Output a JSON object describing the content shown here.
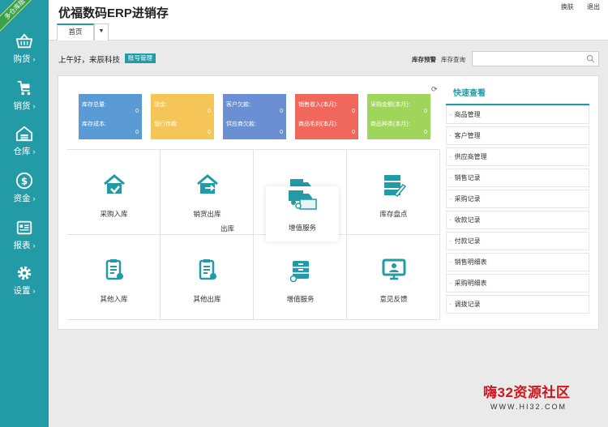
{
  "ribbon": "多仓库版",
  "sidebar": {
    "items": [
      {
        "label": "购货",
        "icon": "basket-icon"
      },
      {
        "label": "销货",
        "icon": "cart-icon"
      },
      {
        "label": "仓库",
        "icon": "warehouse-icon"
      },
      {
        "label": "资金",
        "icon": "money-icon"
      },
      {
        "label": "报表",
        "icon": "report-icon"
      },
      {
        "label": "设置",
        "icon": "gear-icon"
      }
    ]
  },
  "header": {
    "title": "优福数码ERP进销存",
    "switch_label": "换肤",
    "logout_label": "退出",
    "tabs": [
      {
        "label": "首页"
      }
    ]
  },
  "greeting": {
    "text": "上午好，来辰科技",
    "account_button": "账号管理",
    "stock_warning": "库存预警",
    "stock_query": "库存查询",
    "search_placeholder": ""
  },
  "summary_cards": [
    {
      "color": "#5b9bd5",
      "rows": [
        {
          "label": "库存总量:",
          "value": "0"
        },
        {
          "label": "库存成本:",
          "value": "0"
        }
      ]
    },
    {
      "color": "#f5c558",
      "rows": [
        {
          "label": "现金:",
          "value": "0"
        },
        {
          "label": "银行存款:",
          "value": "0"
        }
      ]
    },
    {
      "color": "#6a8fd3",
      "rows": [
        {
          "label": "客户欠款:",
          "value": "0"
        },
        {
          "label": "供应商欠款:",
          "value": "0"
        }
      ]
    },
    {
      "color": "#f0685c",
      "rows": [
        {
          "label": "销售收入(本月):",
          "value": "0"
        },
        {
          "label": "商品毛利(本月):",
          "value": "0"
        }
      ]
    },
    {
      "color": "#9fd55a",
      "rows": [
        {
          "label": "采购金额(本月):",
          "value": "0"
        },
        {
          "label": "商品种类(本月):",
          "value": "0"
        }
      ]
    }
  ],
  "shortcuts": [
    {
      "label": "采购入库",
      "icon": "purchase-in-icon"
    },
    {
      "label": "销货出库",
      "icon": "sales-out-icon"
    },
    {
      "label": "",
      "icon": ""
    },
    {
      "label": "库存盘点",
      "icon": "inventory-check-icon"
    },
    {
      "label": "其他入库",
      "icon": "other-in-icon"
    },
    {
      "label": "其他出库",
      "icon": "other-out-icon"
    },
    {
      "label": "增值服务",
      "icon": "cabinet-icon"
    },
    {
      "label": "意见反馈",
      "icon": "feedback-icon"
    }
  ],
  "overlay": {
    "label": "增值服务",
    "icon": "truck-icon"
  },
  "fragments": {
    "left": "出库",
    "right": ""
  },
  "quick_view": {
    "title": "快速查看",
    "items": [
      "商品管理",
      "客户管理",
      "供应商管理",
      "销售记录",
      "采购记录",
      "收款记录",
      "付款记录",
      "销售明细表",
      "采购明细表",
      "调拨记录"
    ]
  },
  "watermark": {
    "cn": "嗨32资源社区",
    "url": "WWW.HI32.COM"
  },
  "colors": {
    "accent": "#239ba7",
    "ribbon": "#3aa34a",
    "watermark": "#d2141d"
  }
}
